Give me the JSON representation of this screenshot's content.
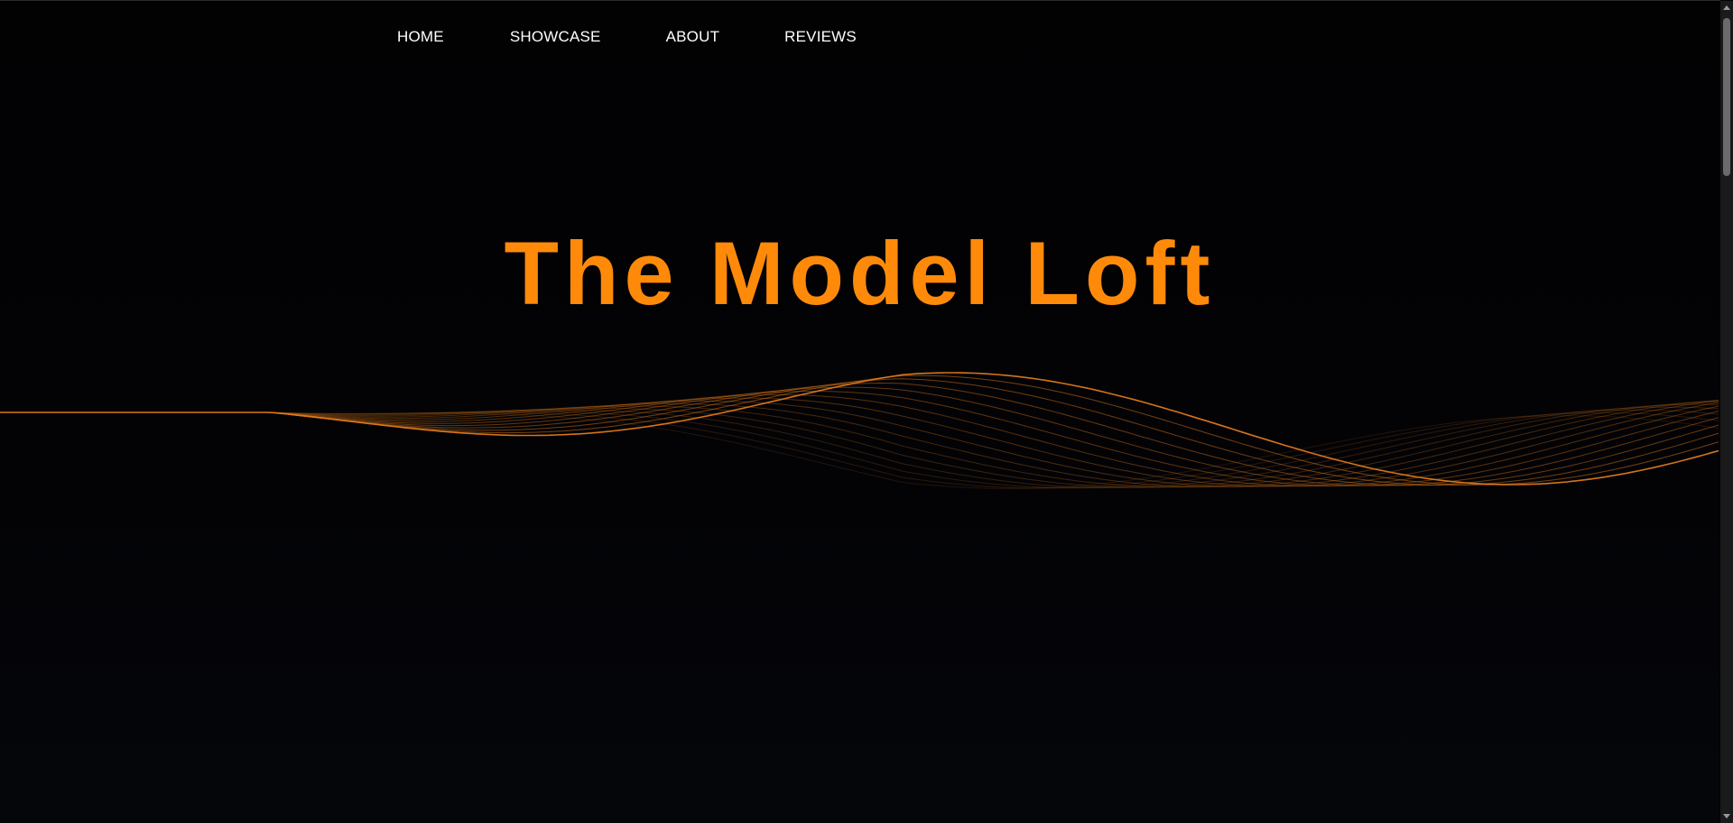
{
  "nav": {
    "items": [
      {
        "label": "HOME"
      },
      {
        "label": "SHOWCASE"
      },
      {
        "label": "ABOUT"
      },
      {
        "label": "REVIEWS"
      }
    ]
  },
  "hero": {
    "title": "The Model Loft"
  },
  "colors": {
    "background": "#030305",
    "accent": "#ff8a0a",
    "nav_text": "#ffffff",
    "wave": "#e07a1a"
  }
}
